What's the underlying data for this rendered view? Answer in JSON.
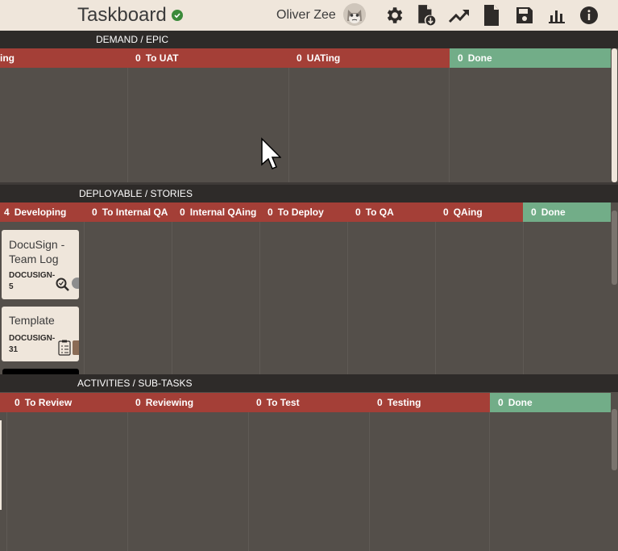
{
  "header": {
    "title": "Taskboard",
    "user": "Oliver Zee",
    "icons": [
      "settings-icon",
      "download-file-icon",
      "trending-icon",
      "document-icon",
      "save-icon",
      "bar-chart-icon",
      "info-icon"
    ]
  },
  "sections": [
    {
      "title": "DEMAND / EPIC",
      "columns": [
        {
          "count": "",
          "label": "ing"
        },
        {
          "count": "0",
          "label": "To UAT"
        },
        {
          "count": "0",
          "label": "UATing"
        },
        {
          "count": "0",
          "label": "Done"
        }
      ]
    },
    {
      "title": "DEPLOYABLE / STORIES",
      "columns": [
        {
          "count": "4",
          "label": "Developing"
        },
        {
          "count": "0",
          "label": "To Internal QA"
        },
        {
          "count": "0",
          "label": "Internal QAing"
        },
        {
          "count": "0",
          "label": "To Deploy"
        },
        {
          "count": "0",
          "label": "To QA"
        },
        {
          "count": "0",
          "label": "QAing"
        },
        {
          "count": "0",
          "label": "Done"
        }
      ],
      "cards": [
        {
          "title": "DocuSign - Team Log",
          "id": "DOCUSIGN-5"
        },
        {
          "title": "Template",
          "id": "DOCUSIGN-31"
        }
      ]
    },
    {
      "title": "ACTIVITIES / SUB-TASKS",
      "columns": [
        {
          "count": "0",
          "label": "To Review"
        },
        {
          "count": "0",
          "label": "Reviewing"
        },
        {
          "count": "0",
          "label": "To Test"
        },
        {
          "count": "0",
          "label": "Testing"
        },
        {
          "count": "0",
          "label": "Done"
        }
      ]
    }
  ],
  "colors": {
    "header_bg": "#efe6db",
    "column_active": "#a43f37",
    "column_done": "#72ad88",
    "board_bg": "#544f4a",
    "section_title_bg": "#2e2b29"
  }
}
